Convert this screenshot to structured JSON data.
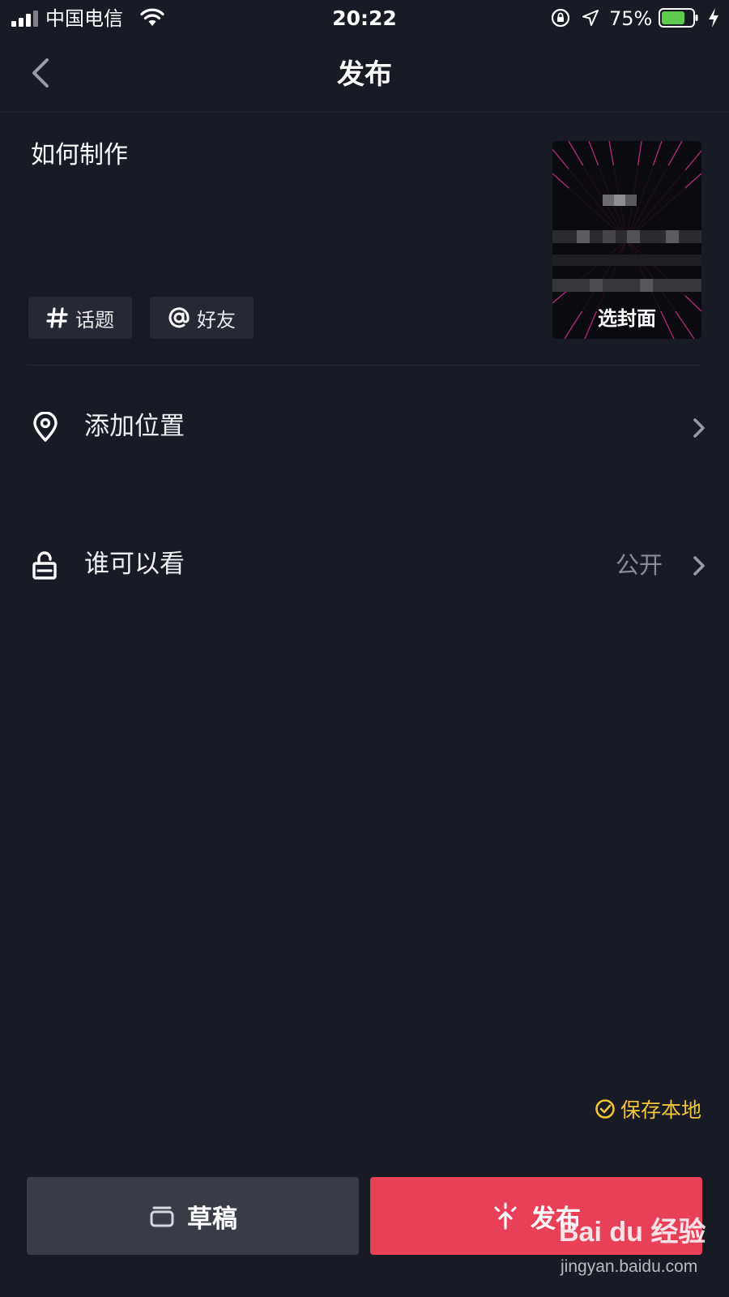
{
  "status_bar": {
    "carrier": "中国电信",
    "time": "20:22",
    "battery_percent": "75%",
    "battery_level": 0.75,
    "battery_color": "#5ecb4f"
  },
  "nav": {
    "title": "发布",
    "back_icon": "chevron-left-icon"
  },
  "compose": {
    "caption": "如何制作",
    "chips": [
      {
        "label": "话题",
        "icon": "hashtag-icon"
      },
      {
        "label": "好友",
        "icon": "at-icon"
      }
    ],
    "cover_label": "选封面"
  },
  "settings": {
    "location": {
      "label": "添加位置",
      "icon": "location-pin-icon"
    },
    "visibility": {
      "label": "谁可以看",
      "value": "公开",
      "icon": "unlock-icon"
    }
  },
  "footer": {
    "save_local": "保存本地",
    "save_local_color": "#f2c43a",
    "draft_label": "草稿",
    "publish_label": "发布",
    "publish_color": "#e9405a"
  },
  "watermark": {
    "brand": "Bai du 经验",
    "url": "jingyan.baidu.com"
  }
}
